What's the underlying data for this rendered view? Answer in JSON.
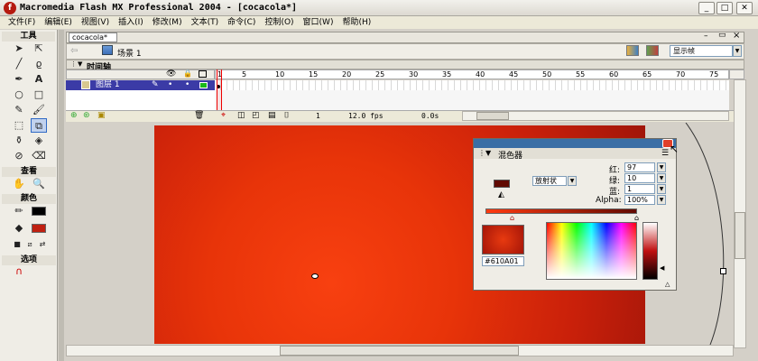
{
  "window": {
    "title": "Macromedia Flash MX Professional 2004 - [cocacola*]",
    "icon": "flash-icon",
    "btn_min": "_",
    "btn_max": "□",
    "btn_close": "✕"
  },
  "menu": [
    "文件(F)",
    "编辑(E)",
    "视图(V)",
    "插入(I)",
    "修改(M)",
    "文本(T)",
    "命令(C)",
    "控制(O)",
    "窗口(W)",
    "帮助(H)"
  ],
  "toolbox": {
    "tools_header": "工具",
    "view_header": "查看",
    "colors_header": "颜色",
    "options_header": "选项"
  },
  "document": {
    "tab": "cocacola*",
    "scene": "场景 1",
    "zoom": "显示帧",
    "doc_btn_min": "–",
    "doc_btn_restore": "▭",
    "doc_btn_close": "×"
  },
  "timeline": {
    "header": "时间轴",
    "ruler": [
      "1",
      "5",
      "10",
      "15",
      "20",
      "25",
      "30",
      "35",
      "40",
      "45",
      "50",
      "55",
      "60",
      "65",
      "70",
      "75"
    ],
    "layer_name": "图层 1",
    "current_frame": "1",
    "frame_rate": "12.0 fps",
    "elapsed": "0.0s"
  },
  "mixer": {
    "title": "混色器",
    "fill_type": "放射状",
    "red_label": "红:",
    "red": "97",
    "green_label": "绿:",
    "green": "10",
    "blue_label": "蓝:",
    "blue": "1",
    "alpha_label": "Alpha:",
    "alpha": "100%",
    "hex": "#610A01",
    "colors": {
      "swatch": "#610A01",
      "gradient_start": "#ff3a10",
      "gradient_end": "#610A01"
    }
  }
}
